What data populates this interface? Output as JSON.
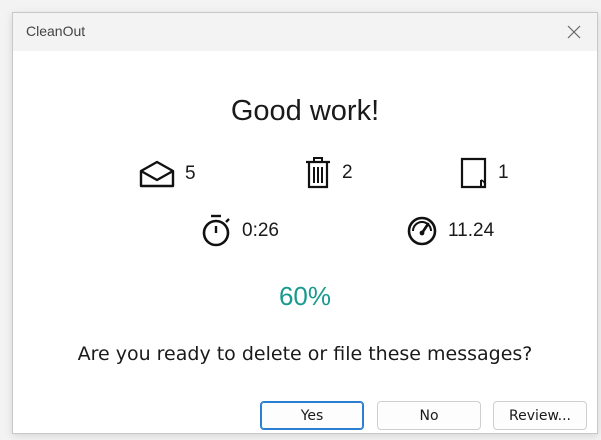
{
  "window": {
    "title": "CleanOut"
  },
  "headline": "Good work!",
  "stats": {
    "opened_mail": "5",
    "deleted": "2",
    "filed": "1",
    "time": "0:26",
    "speed": "11.24"
  },
  "icons": {
    "opened_mail": "open-envelope-icon",
    "deleted": "trash-icon",
    "filed": "folder-icon",
    "time": "stopwatch-icon",
    "speed": "speedometer-icon",
    "close": "close-icon"
  },
  "progress_percent": "60%",
  "question": "Are you ready to delete or file these messages?",
  "buttons": {
    "yes": "Yes",
    "no": "No",
    "review": "Review..."
  },
  "colors": {
    "accent": "#1a9a8e",
    "default_button_border": "#2a7fd2"
  }
}
